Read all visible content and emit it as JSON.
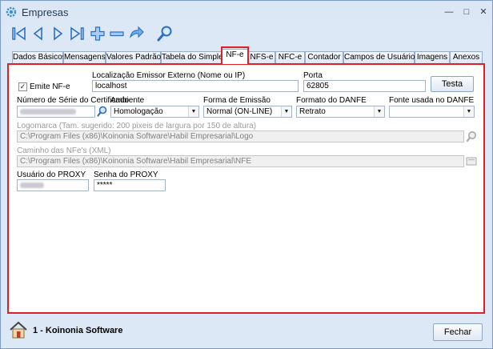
{
  "window": {
    "title": "Empresas"
  },
  "toolbar": {
    "items": [
      "first-icon",
      "previous-icon",
      "next-icon",
      "last-icon",
      "add-icon",
      "remove-icon",
      "undo-icon",
      "search-icon"
    ]
  },
  "tabs": [
    "Dados Básicos",
    "Mensagens",
    "Valores Padrão",
    "Tabela do Simples",
    "NF-e",
    "NFS-e",
    "NFC-e",
    "Contador",
    "Campos de Usuários",
    "Imagens",
    "Anexos"
  ],
  "active_tab": "NF-e",
  "form": {
    "emite_nfe_label": "Emite NF-e",
    "emite_nfe_checked": true,
    "emissor_label": "Localização Emissor Externo (Nome ou IP)",
    "emissor_value": "localhost",
    "porta_label": "Porta",
    "porta_value": "62805",
    "testa_label": "Testa",
    "certificado_label": "Número de Série do Certificado",
    "ambiente_label": "Ambiente",
    "ambiente_value": "Homologação",
    "forma_label": "Forma de Emissão",
    "forma_value": "Normal (ON-LINE)",
    "formato_label": "Formato do DANFE",
    "formato_value": "Retrato",
    "fonte_label": "Fonte usada no DANFE",
    "fonte_value": "",
    "logomarca_label": "Logomarca (Tam. sugerido: 200 pixeis de largura por 150 de altura)",
    "logomarca_value": "C:\\Program Files (x86)\\Koinonia Software\\Habil Empresarial\\Logo",
    "caminho_label": "Caminho das NFe's (XML)",
    "caminho_value": "C:\\Program Files (x86)\\Koinonia Software\\Habil Empresarial\\NFE",
    "usuario_label": "Usuário do PROXY",
    "senha_label": "Senha do PROXY",
    "senha_value": "*****"
  },
  "footer": {
    "company": "1 - Koinonia Software",
    "fechar_label": "Fechar"
  }
}
